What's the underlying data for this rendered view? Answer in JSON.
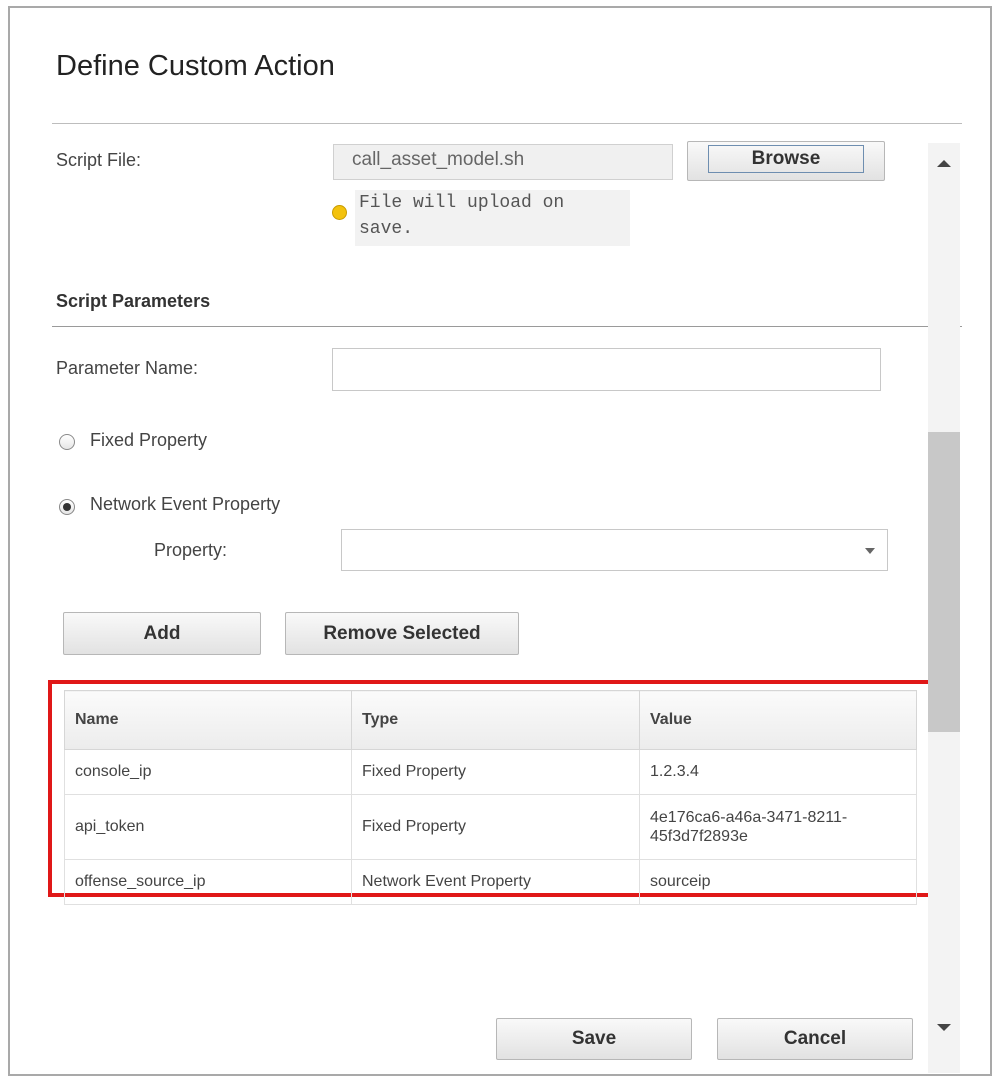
{
  "dialog": {
    "title": "Define Custom Action"
  },
  "script_file": {
    "label": "Script File:",
    "value": "call_asset_model.sh",
    "browse_label": "Browse",
    "note_line1": "File will upload on",
    "note_line2": "save."
  },
  "script_parameters": {
    "section_title": "Script Parameters",
    "parameter_name_label": "Parameter Name:",
    "parameter_name_value": "",
    "fixed_property_label": "Fixed Property",
    "network_event_property_label": "Network Event Property",
    "selected_option": "Network Event Property",
    "property_label": "Property:",
    "property_value": "",
    "add_label": "Add",
    "remove_selected_label": "Remove Selected"
  },
  "table": {
    "columns": [
      "Name",
      "Type",
      "Value"
    ],
    "rows": [
      {
        "name": "console_ip",
        "type": "Fixed Property",
        "value": "1.2.3.4"
      },
      {
        "name": "api_token",
        "type": "Fixed Property",
        "value_line1": "4e176ca6-a46a-3471-8211-",
        "value_line2": "45f3d7f2893e"
      },
      {
        "name": "offense_source_ip",
        "type": "Network Event Property",
        "value": "sourceip"
      }
    ]
  },
  "footer": {
    "save_label": "Save",
    "cancel_label": "Cancel"
  },
  "colors": {
    "highlight_border": "#e01818",
    "note_icon": "#f3c20d"
  },
  "icons": [
    "info-icon",
    "chevron-down-icon",
    "scroll-up-arrow-icon",
    "scroll-down-arrow-icon"
  ]
}
